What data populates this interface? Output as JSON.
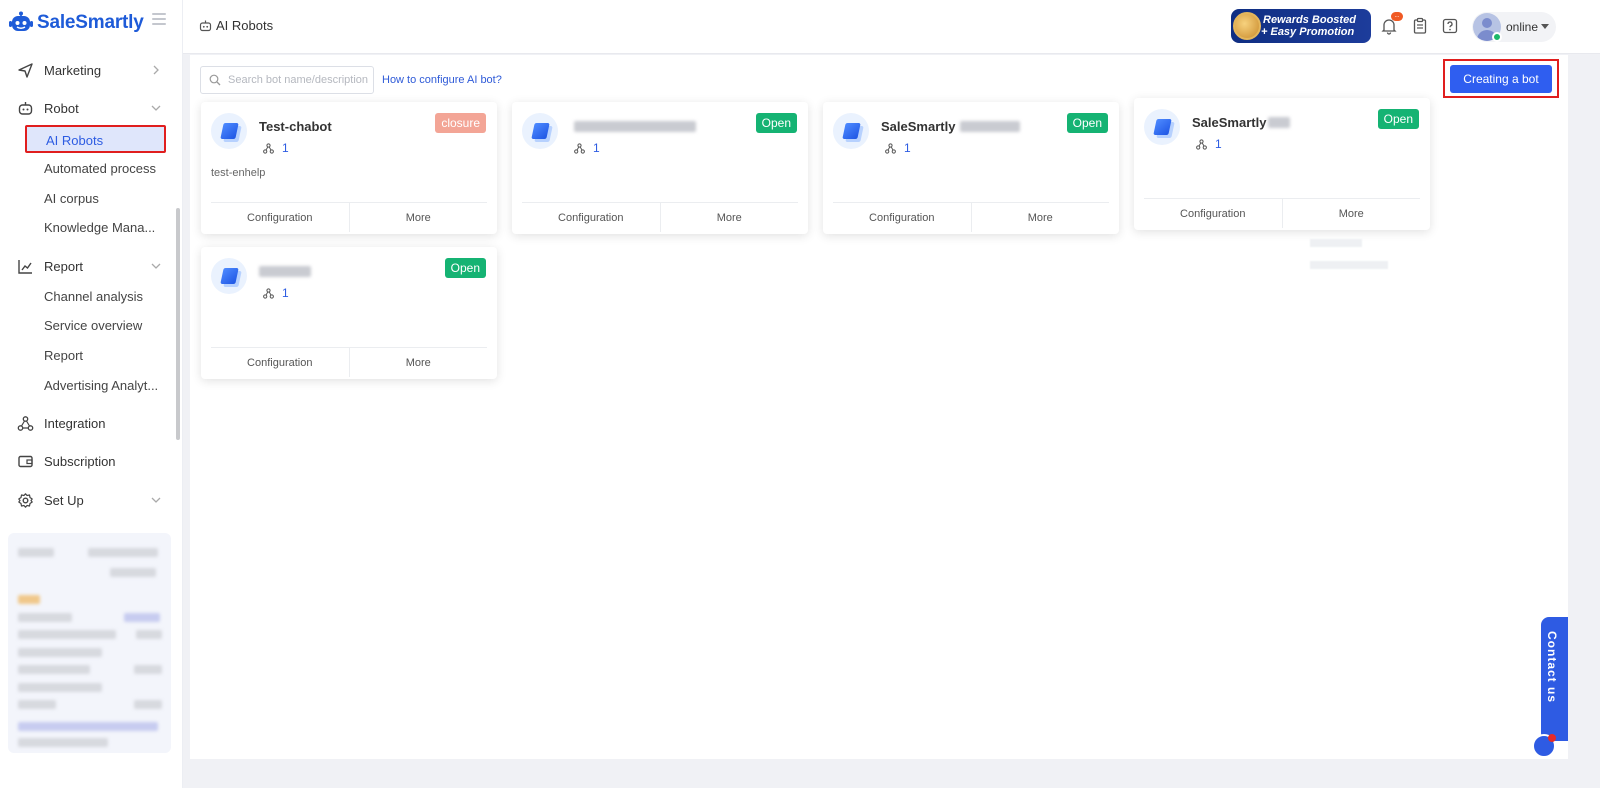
{
  "brand": {
    "name": "SaleSmartly",
    "color": "#1e5bd8"
  },
  "sidebar": {
    "groups": [
      {
        "label": "Marketing",
        "icon": "send-icon"
      },
      {
        "label": "Robot",
        "icon": "robot-icon"
      },
      {
        "label": "Report",
        "icon": "chart-icon"
      },
      {
        "label": "Integration",
        "icon": "integration-icon"
      },
      {
        "label": "Subscription",
        "icon": "wallet-icon"
      },
      {
        "label": "Set Up",
        "icon": "gear-icon"
      }
    ],
    "robot_items": [
      "AI Robots",
      "Automated process",
      "AI corpus",
      "Knowledge Mana..."
    ],
    "report_items": [
      "Channel analysis",
      "Service overview",
      "Report",
      "Advertising Analyt..."
    ]
  },
  "topbar": {
    "breadcrumb": "AI Robots",
    "rewards_line1": "Rewards Boosted",
    "rewards_line2": "+ Easy Promotion",
    "notification_badge": "...",
    "status": "online"
  },
  "main": {
    "search_placeholder": "Search bot name/description",
    "help_link": "How to configure AI bot?",
    "create_button": "Creating a bot"
  },
  "bots": [
    {
      "name": "Test-chabot",
      "count": "1",
      "status": "closure",
      "description": "test-enhelp"
    },
    {
      "name": "",
      "count": "1",
      "status": "Open",
      "description": ""
    },
    {
      "name": "SaleSmartly",
      "count": "1",
      "status": "Open",
      "description": ""
    },
    {
      "name": "SaleSmartly",
      "count": "1",
      "status": "Open",
      "description": ""
    },
    {
      "name": "",
      "count": "1",
      "status": "Open",
      "description": ""
    }
  ],
  "card_actions": {
    "configuration": "Configuration",
    "more": "More"
  },
  "contact": {
    "label": "Contact us"
  },
  "colors": {
    "primary": "#2f5ef0",
    "open": "#15b373",
    "closure": "#f3a596",
    "highlight": "#e01e1e"
  }
}
